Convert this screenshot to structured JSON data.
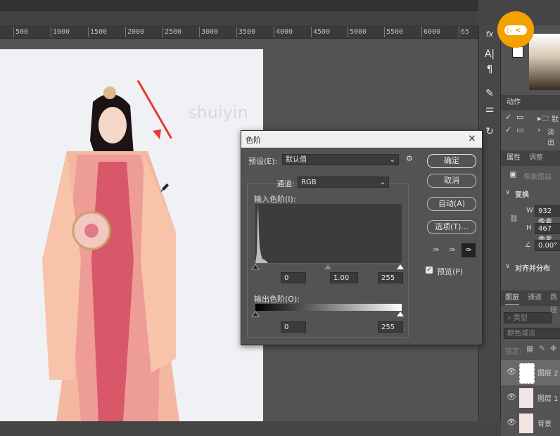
{
  "ruler": {
    "ticks": [
      "500",
      "1000",
      "1500",
      "2000",
      "2500",
      "3000",
      "3500",
      "4000",
      "4500",
      "5000",
      "5500",
      "6000",
      "65"
    ]
  },
  "canvas": {
    "watermark": "shuiyin"
  },
  "toolstrip": {
    "icons": [
      "fx-icon",
      "text-icon",
      "paragraph-icon",
      "brush-settings-icon",
      "adjust-icon",
      "history-icon"
    ]
  },
  "panels": {
    "actions_tab": "动作",
    "actions": [
      {
        "label": "默"
      },
      {
        "label": "淡出"
      }
    ],
    "properties_tab": "属性",
    "adjustments_tab": "调整",
    "pixel_layer": "像素图层",
    "transform_title": "变换",
    "w_label": "W",
    "w_value": "932 像素",
    "h_label": "H",
    "h_value": "467 像素",
    "angle_value": "0.00°",
    "align_title": "对齐并分布",
    "layers_tab": "图层",
    "channels_tab": "通道",
    "paths_tab": "路径",
    "kind_placeholder": "类型",
    "blend_mode": "颜色减淡",
    "lock_label": "锁定:",
    "layers": [
      {
        "name": "图层 2"
      },
      {
        "name": "图层 1"
      },
      {
        "name": "背景"
      }
    ],
    "top_tab_partial": "页"
  },
  "dialog": {
    "title": "色阶",
    "preset_label": "预设(E):",
    "preset_value": "默认值",
    "channel_label": "通道:",
    "channel_value": "RGB",
    "input_levels_label": "输入色阶(I):",
    "input_black": "0",
    "input_gamma": "1.00",
    "input_white": "255",
    "output_levels_label": "输出色阶(O):",
    "output_black": "0",
    "output_white": "255",
    "ok_label": "确定",
    "cancel_label": "取消",
    "auto_label": "自动(A)",
    "options_label": "选项(T)...",
    "preview_label": "预览(P)",
    "preview_checked": true
  }
}
